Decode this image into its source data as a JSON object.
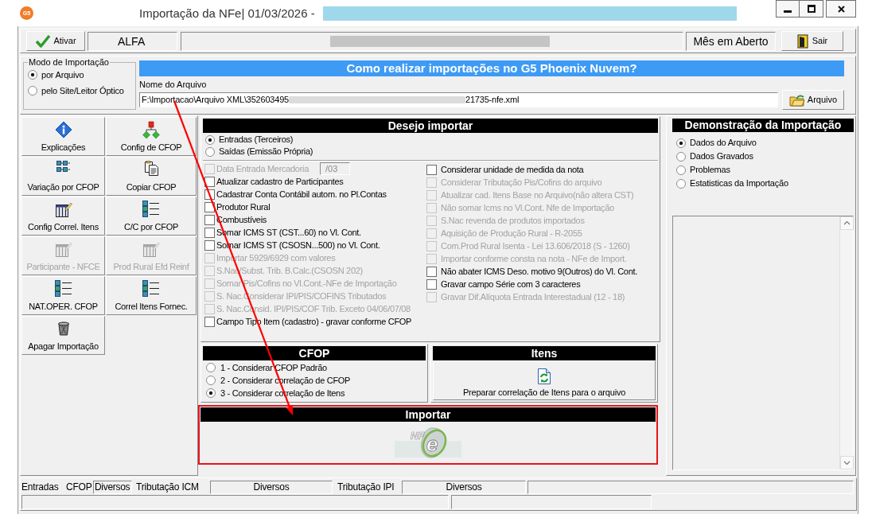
{
  "window": {
    "icon_text": "G5",
    "title": "Importação da NFe| 01/03/2026 -"
  },
  "toolbar": {
    "activate_button": "Ativar",
    "company": "ALFA",
    "period_status": "Mês em Aberto",
    "exit_button": "Sair"
  },
  "import_mode": {
    "title": "Modo de Importação",
    "options": [
      {
        "label": "por Arquivo",
        "selected": true
      },
      {
        "label": "pelo Site/Leitor Óptico",
        "selected": false
      }
    ]
  },
  "help_banner": "Como realizar importações no G5 Phoenix Nuvem?",
  "file": {
    "label": "Nome do Arquivo",
    "value_start": "F:\\Importacao\\Arquivo XML\\352603495",
    "value_end": "21735-nfe.xml",
    "button": "Arquivo"
  },
  "actions": [
    {
      "label": "Explicações",
      "kind": "info",
      "disabled": false
    },
    {
      "label": "Config de CFOP",
      "kind": "hierarchy",
      "disabled": false
    },
    {
      "label": "Variação por CFOP",
      "kind": "grid",
      "disabled": false
    },
    {
      "label": "Copiar CFOP",
      "kind": "copy",
      "disabled": false
    },
    {
      "label": "Config Correl. Itens",
      "kind": "table",
      "disabled": false
    },
    {
      "label": "C/C por CFOP",
      "kind": "list",
      "disabled": false
    },
    {
      "label": "Participante - NFCE",
      "kind": "table",
      "disabled": true
    },
    {
      "label": "Prod Rural Efd Reinf",
      "kind": "table",
      "disabled": true
    },
    {
      "label": "NAT.OPER. CFOP",
      "kind": "list",
      "disabled": false
    },
    {
      "label": "Correl Itens Fornec.",
      "kind": "list",
      "disabled": false
    },
    {
      "label": "Apagar Importação",
      "kind": "trash",
      "disabled": false
    }
  ],
  "import_options": {
    "title": "Desejo importar",
    "direction": [
      {
        "label": "Entradas (Terceiros)",
        "selected": true
      },
      {
        "label": "Saídas (Emissão Própria)",
        "selected": false
      }
    ],
    "left": [
      {
        "label": "Data Entrada Mercadoria",
        "kind": "date",
        "checked": false,
        "disabled": true,
        "value": "/03"
      },
      {
        "label": "Atualizar cadastro de Participantes",
        "kind": "plain",
        "checked": false,
        "disabled": false
      },
      {
        "label": "Cadastrar Conta Contábil autom. no Pl.Contas",
        "kind": "plain",
        "checked": false,
        "disabled": false
      },
      {
        "label": "Produtor Rural",
        "kind": "plain",
        "checked": false,
        "disabled": false
      },
      {
        "label": "Combustíveis",
        "kind": "plain",
        "checked": false,
        "disabled": false
      },
      {
        "label": "Somar ICMS ST (CST...60) no Vl. Cont.",
        "kind": "plain",
        "checked": false,
        "disabled": false
      },
      {
        "label": "Somar ICMS ST (CSOSN...500) no Vl. Cont.",
        "kind": "plain",
        "checked": false,
        "disabled": false
      },
      {
        "label": "Importar 5929/6929 com valores",
        "kind": "plain",
        "checked": false,
        "disabled": true
      },
      {
        "label": "S.Nac/Subst. Trib. B.Calc.(CSOSN 202)",
        "kind": "plain",
        "checked": false,
        "disabled": true
      },
      {
        "label": "Somar Pis/Cofins no Vl.Cont.-NFe de Importação",
        "kind": "plain",
        "checked": false,
        "disabled": true
      },
      {
        "label": "S. Nac.Considerar IPI/PIS/COFINS Tributados",
        "kind": "plain",
        "checked": false,
        "disabled": true
      },
      {
        "label": "S. Nac.Consid. IPI/PIS/COF Trib. Exceto 04/06/07/08",
        "kind": "plain",
        "checked": false,
        "disabled": true
      },
      {
        "label": "Campo Tipo Item (cadastro) - gravar conforme CFOP",
        "kind": "plain",
        "checked": false,
        "disabled": false
      }
    ],
    "right": [
      {
        "label": "Considerar unidade de medida da nota",
        "checked": false,
        "disabled": false
      },
      {
        "label": "Considerar Tributação Pis/Cofins do arquivo",
        "checked": false,
        "disabled": true
      },
      {
        "label": "Atualizar cad. Itens Base no Arquivo(não altera CST)",
        "checked": false,
        "disabled": true
      },
      {
        "label": "Não somar Icms no Vl.Cont. Nfe de Importação",
        "checked": false,
        "disabled": true
      },
      {
        "label": "S.Nac revenda de produtos importados",
        "checked": false,
        "disabled": true
      },
      {
        "label": "Aquisição de Produção Rural - R-2055",
        "checked": false,
        "disabled": true
      },
      {
        "label": "Com.Prod Rural Isenta - Lei 13.606/2018 (S - 1260)",
        "checked": false,
        "disabled": true
      },
      {
        "label": "Importar conforme consta na nota - NFe de Import.",
        "checked": false,
        "disabled": true
      },
      {
        "label": "Não abater ICMS Deso. motivo 9(Outros) do Vl. Cont.",
        "checked": false,
        "disabled": false
      },
      {
        "label": "Gravar campo Série com 3 caracteres",
        "checked": false,
        "disabled": false
      },
      {
        "label": "Gravar Dif.Alíquota Entrada Interestadual (12 - 18)",
        "checked": false,
        "disabled": true
      }
    ]
  },
  "cfop": {
    "title": "CFOP",
    "options": [
      {
        "label": "1 - Considerar CFOP Padrão",
        "selected": false
      },
      {
        "label": "2 - Considerar correlação de CFOP",
        "selected": false
      },
      {
        "label": "3 - Considerar correlação de Itens",
        "selected": true
      }
    ]
  },
  "items": {
    "title": "Itens",
    "button": "Preparar correlação de Itens para o arquivo"
  },
  "import": {
    "title": "Importar",
    "logo_text": "NF",
    "logo_letter": "e"
  },
  "preview": {
    "title": "Demonstração da Importação",
    "options": [
      {
        "label": "Dados do Arquivo",
        "selected": true
      },
      {
        "label": "Dados Gravados",
        "selected": false
      },
      {
        "label": "Problemas",
        "selected": false
      },
      {
        "label": "Estatisticas da Importação",
        "selected": false
      }
    ]
  },
  "status_bar": {
    "cells": [
      {
        "text": "Entradas",
        "kind": "label"
      },
      {
        "text": "CFOP",
        "kind": "label"
      },
      {
        "text": "Diversos",
        "kind": "box"
      },
      {
        "text": "Tributação ICM",
        "kind": "label"
      },
      {
        "text": "Diversos",
        "kind": "field"
      },
      {
        "text": "Tributação IPI",
        "kind": "label"
      },
      {
        "text": "Diversos",
        "kind": "field"
      }
    ]
  }
}
